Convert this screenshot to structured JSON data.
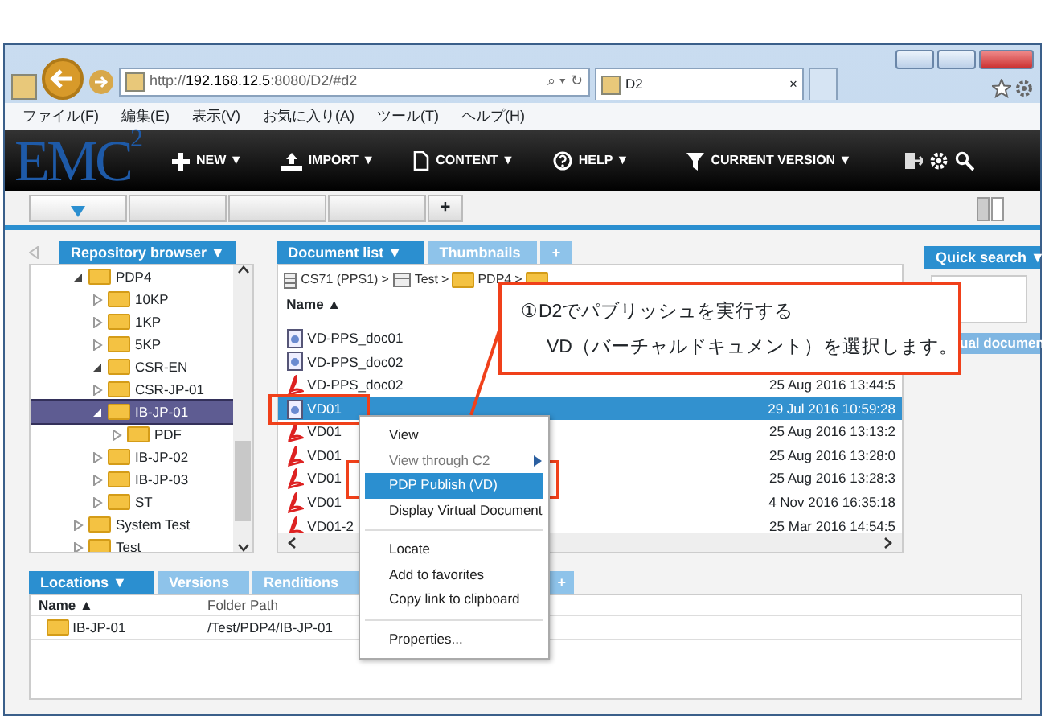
{
  "browser": {
    "url": "http://**192.168.12.5**:8080/D2/#d2",
    "url_tools": [
      "⌕ ▾",
      "↻"
    ],
    "tab": {
      "title": "D2",
      "close": "×"
    },
    "menu": [
      "ファイル(F)",
      "編集(E)",
      "表示(V)",
      "お気に入り(A)",
      "ツール(T)",
      "ヘルプ(H)"
    ]
  },
  "app": {
    "logo": "EMC$^{2}$",
    "nav": [
      {
        "kind": "plus",
        "label": "NEW ▼"
      },
      {
        "kind": "import",
        "label": "IMPORT ▼"
      },
      {
        "kind": "doc",
        "label": "CONTENT ▼"
      },
      {
        "kind": "help",
        "label": "HELP ▼"
      }
    ],
    "filter": "CURRENT VERSION ▼",
    "workspace_tabs": [
      {
        "selected": true
      },
      {
        "selected": false
      },
      {
        "selected": false
      },
      {
        "selected": false
      }
    ],
    "add_tab": "+"
  },
  "repository": {
    "title": "Repository browser ▼",
    "tree": [
      {
        "label": "PDP4",
        "expanded": true,
        "selected": false,
        "children": [
          {
            "label": "10KP",
            "expanded": false,
            "selected": false
          },
          {
            "label": "1KP",
            "expanded": false,
            "selected": false
          },
          {
            "label": "5KP",
            "expanded": false,
            "selected": false
          },
          {
            "label": "CSR-EN",
            "expanded": true,
            "selected": false
          },
          {
            "label": "CSR-JP-01",
            "expanded": false,
            "selected": false
          },
          {
            "label": "IB-JP-01",
            "expanded": true,
            "selected": true,
            "children": [
              {
                "label": "PDF",
                "expanded": false,
                "selected": false
              }
            ]
          },
          {
            "label": "IB-JP-02",
            "expanded": false,
            "selected": false
          },
          {
            "label": "IB-JP-03",
            "expanded": false,
            "selected": false
          },
          {
            "label": "ST",
            "expanded": false,
            "selected": false
          }
        ]
      },
      {
        "label": "System Test",
        "expanded": false,
        "selected": false
      },
      {
        "label": "Test",
        "expanded": false,
        "selected": false
      }
    ]
  },
  "document_list": {
    "tabs": [
      {
        "label": "Document list ▼",
        "selected": true
      },
      {
        "label": "Thumbnails",
        "selected": false
      },
      {
        "label": "+",
        "selected": false
      }
    ],
    "breadcrumb": [
      {
        "kind": "server",
        "label": "CS71 (PPS1)"
      },
      {
        "kind": "cabinet",
        "label": "Test"
      },
      {
        "kind": "folder",
        "label": "PDP4"
      }
    ],
    "separator": ">",
    "column": "Name ▲",
    "rows": [
      {
        "kind": "vd",
        "name": "VD-PPS_doc01",
        "selected": false
      },
      {
        "kind": "vd",
        "name": "VD-PPS_doc02",
        "selected": false
      },
      {
        "kind": "pdf",
        "name": "VD-PPS_doc02",
        "date": "25 Aug 2016 13:44:5",
        "selected": false
      },
      {
        "kind": "vd",
        "name": "VD01",
        "date": "29 Jul 2016 10:59:28",
        "selected": true
      },
      {
        "kind": "pdf",
        "name": "VD01",
        "date": "25 Aug 2016 13:13:2",
        "selected": false
      },
      {
        "kind": "pdf",
        "name": "VD01",
        "date": "25 Aug 2016 13:28:0",
        "selected": false
      },
      {
        "kind": "pdf",
        "name": "VD01",
        "date": "25 Aug 2016 13:28:3",
        "selected": false
      },
      {
        "kind": "pdf",
        "name": "VD01",
        "date": "4 Nov 2016 16:35:18",
        "selected": false
      },
      {
        "kind": "pdf",
        "name": "VD01-2",
        "date": "25 Mar 2016 14:54:5",
        "selected": false
      }
    ]
  },
  "quick_search": {
    "title": "Quick search ▼",
    "bar": "ual documen"
  },
  "bottom": {
    "tabs": [
      {
        "label": "Locations ▼",
        "selected": true
      },
      {
        "label": "Versions",
        "selected": false
      },
      {
        "label": "Renditions",
        "selected": false
      }
    ],
    "columns": [
      "Name ▲",
      "Folder Path"
    ],
    "add_tab": "+",
    "rows": [
      {
        "name": "IB-JP-01",
        "path": "/Test/PDP4/IB-JP-01"
      }
    ]
  },
  "context_menu": [
    {
      "kind": "item",
      "label": "View",
      "disabled": false,
      "selected": false
    },
    {
      "kind": "submenu",
      "label": "View through C2",
      "disabled": true,
      "selected": false
    },
    {
      "kind": "item",
      "label": "PDP Publish (VD)",
      "disabled": false,
      "selected": true
    },
    {
      "kind": "item",
      "label": "Display Virtual Document",
      "disabled": false,
      "selected": false
    },
    {
      "kind": "divider"
    },
    {
      "kind": "item",
      "label": "Locate",
      "disabled": false,
      "selected": false
    },
    {
      "kind": "item",
      "label": "Add to favorites",
      "disabled": false,
      "selected": false
    },
    {
      "kind": "item",
      "label": "Copy link to clipboard",
      "disabled": false,
      "selected": false
    },
    {
      "kind": "divider"
    },
    {
      "kind": "item",
      "label": "Properties...",
      "disabled": false,
      "selected": false
    }
  ],
  "callout": {
    "lines": [
      "①D2でパブリッシュを実行する",
      "VD（バーチャルドキュメント）を選択します。"
    ]
  }
}
